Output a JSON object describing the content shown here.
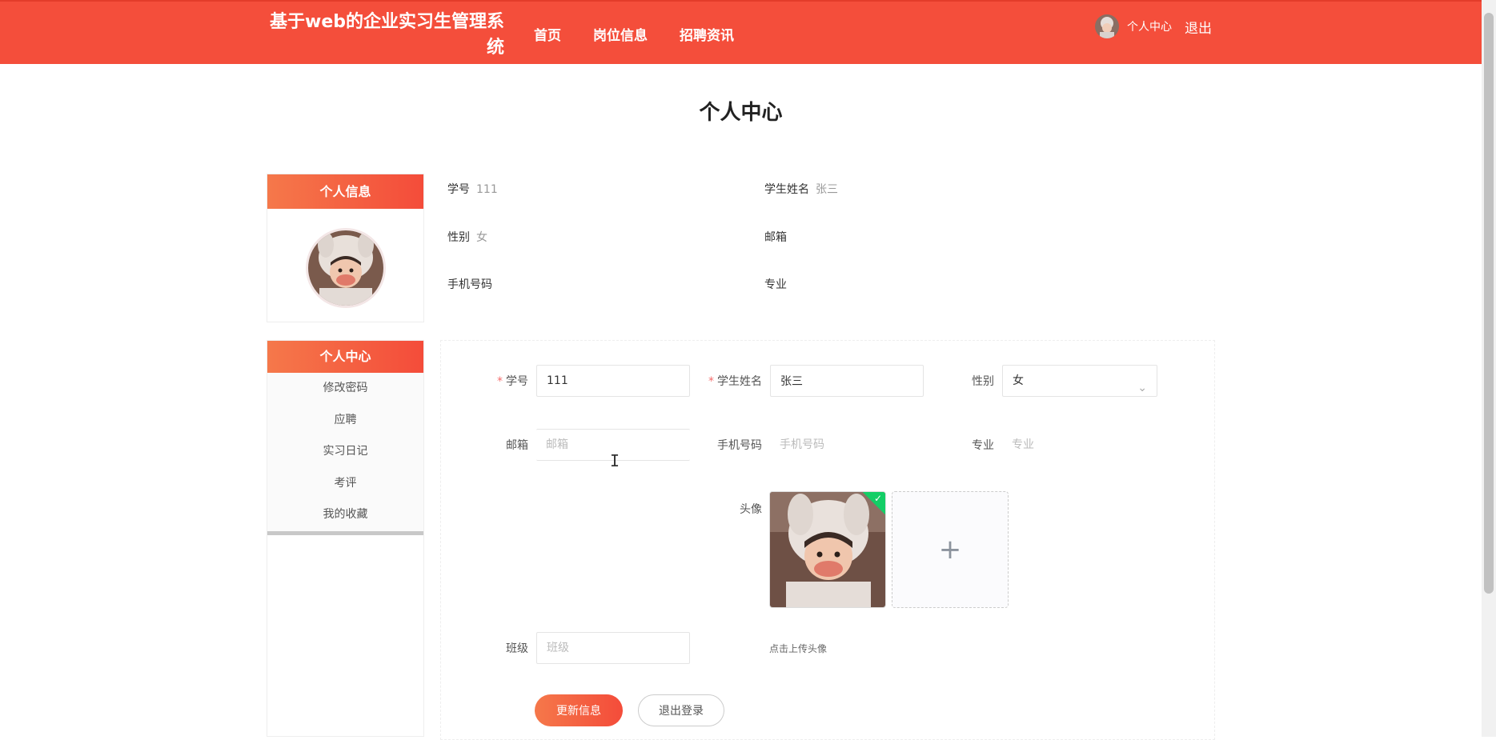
{
  "header": {
    "site_title": "基于web的企业实习生管理系统",
    "nav": [
      "首页",
      "岗位信息",
      "招聘资讯"
    ],
    "user_center": "个人中心",
    "logout": "退出"
  },
  "page_title": "个人中心",
  "info_card": {
    "title": "个人信息",
    "fields": {
      "student_id_label": "学号",
      "student_id_value": "111",
      "name_label": "学生姓名",
      "name_value": "张三",
      "gender_label": "性别",
      "gender_value": "女",
      "email_label": "邮箱",
      "email_value": "",
      "phone_label": "手机号码",
      "phone_value": "",
      "major_label": "专业",
      "major_value": ""
    }
  },
  "menu": {
    "title": "个人中心",
    "items": [
      "修改密码",
      "应聘",
      "实习日记",
      "考评",
      "我的收藏"
    ]
  },
  "form": {
    "student_id": {
      "label": "学号",
      "value": "111",
      "placeholder": ""
    },
    "name": {
      "label": "学生姓名",
      "value": "张三",
      "placeholder": ""
    },
    "gender": {
      "label": "性别",
      "value": "女"
    },
    "email": {
      "label": "邮箱",
      "value": "",
      "placeholder": "邮箱"
    },
    "phone": {
      "label": "手机号码",
      "value": "",
      "placeholder": "手机号码"
    },
    "major": {
      "label": "专业",
      "value": "",
      "placeholder": "专业"
    },
    "avatar": {
      "label": "头像",
      "tip": "点击上传头像",
      "add_symbol": "+"
    },
    "class": {
      "label": "班级",
      "value": "",
      "placeholder": "班级"
    },
    "update_button": "更新信息",
    "logout_button": "退出登录",
    "select_arrow": "⌄"
  },
  "colors": {
    "brand": "#f44e3b",
    "brand_light": "#f5784a",
    "success": "#13ce66"
  },
  "icons": {
    "upload_ok": "check-icon",
    "text_cursor": "ibeam-cursor-icon"
  }
}
